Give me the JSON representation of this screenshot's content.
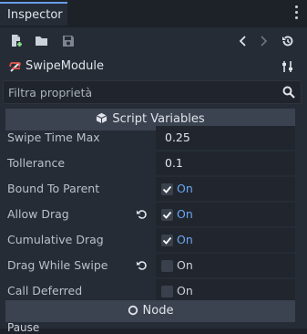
{
  "tab": {
    "title": "Inspector"
  },
  "toolbar": {
    "icons": [
      "new-resource-icon",
      "open-folder-icon",
      "save-icon",
      "back-icon",
      "forward-icon",
      "history-icon"
    ]
  },
  "object": {
    "name": "SwipeModule"
  },
  "filter": {
    "placeholder": "Filtra proprietà"
  },
  "sections": {
    "script_variables": "Script Variables",
    "node": "Node"
  },
  "properties": [
    {
      "label": "Swipe Time Max",
      "value": "0.25"
    },
    {
      "label": "Tollerance",
      "value": "0.1"
    },
    {
      "label": "Bound To Parent",
      "checked": true,
      "state": "On"
    },
    {
      "label": "Allow Drag",
      "checked": true,
      "state": "On",
      "revert": true
    },
    {
      "label": "Cumulative Drag",
      "checked": true,
      "state": "On"
    },
    {
      "label": "Drag While Swipe",
      "checked": false,
      "state": "On",
      "revert": true
    },
    {
      "label": "Call Deferred",
      "checked": false,
      "state": "On"
    }
  ],
  "bottom": {
    "label": "Pause"
  },
  "colors": {
    "accent": "#699ce8",
    "on_text": "#6aa6f2",
    "panel": "#262c36"
  }
}
